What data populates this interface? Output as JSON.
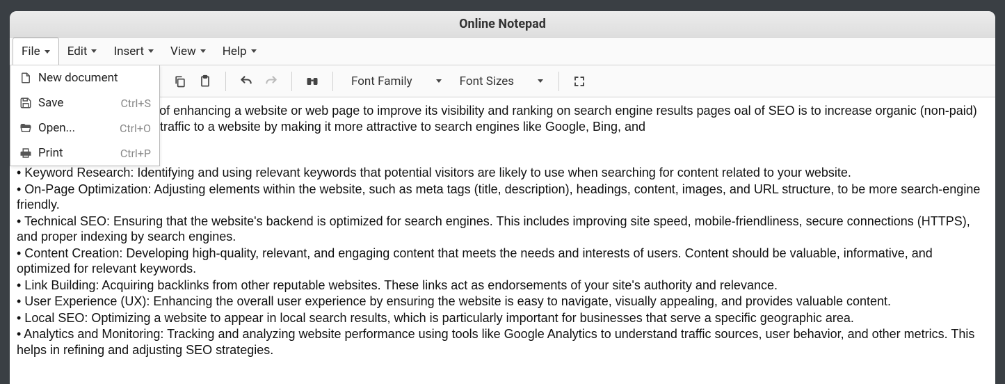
{
  "title": "Online Notepad",
  "menubar": {
    "file": "File",
    "edit": "Edit",
    "insert": "Insert",
    "view": "View",
    "help": "Help"
  },
  "file_menu": {
    "new_document": "New document",
    "save": "Save",
    "save_shortcut": "Ctrl+S",
    "open": "Open...",
    "open_shortcut": "Ctrl+O",
    "print": "Print",
    "print_shortcut": "Ctrl+P"
  },
  "toolbar": {
    "font_family": "Font Family",
    "font_sizes": "Font Sizes"
  },
  "document": {
    "intro": "tion (SEO) is the process of enhancing a website or web page to improve its visibility and ranking on search engine results pages oal of SEO is to increase organic (non-paid) traffic to a website by making it more attractive to search engines like Google, Bing, and",
    "bullets": [
      "• Keyword Research: Identifying and using relevant keywords that potential visitors are likely to use when searching for content related to your website.",
      "• On-Page Optimization: Adjusting elements within the website, such as meta tags (title, description), headings, content, images, and URL structure, to be more search-engine friendly.",
      "• Technical SEO: Ensuring that the website's backend is optimized for search engines. This includes improving site speed, mobile-friendliness, secure connections (HTTPS), and proper indexing by search engines.",
      "• Content Creation: Developing high-quality, relevant, and engaging content that meets the needs and interests of users. Content should be valuable, informative, and optimized for relevant keywords.",
      "• Link Building: Acquiring backlinks from other reputable websites. These links act as endorsements of your site's authority and relevance.",
      "• User Experience (UX): Enhancing the overall user experience by ensuring the website is easy to navigate, visually appealing, and provides valuable content.",
      "• Local SEO: Optimizing a website to appear in local search results, which is particularly important for businesses that serve a specific geographic area.",
      "• Analytics and Monitoring: Tracking and analyzing website performance using tools like Google Analytics to understand traffic sources, user behavior, and other metrics. This helps in refining and adjusting SEO strategies."
    ]
  }
}
